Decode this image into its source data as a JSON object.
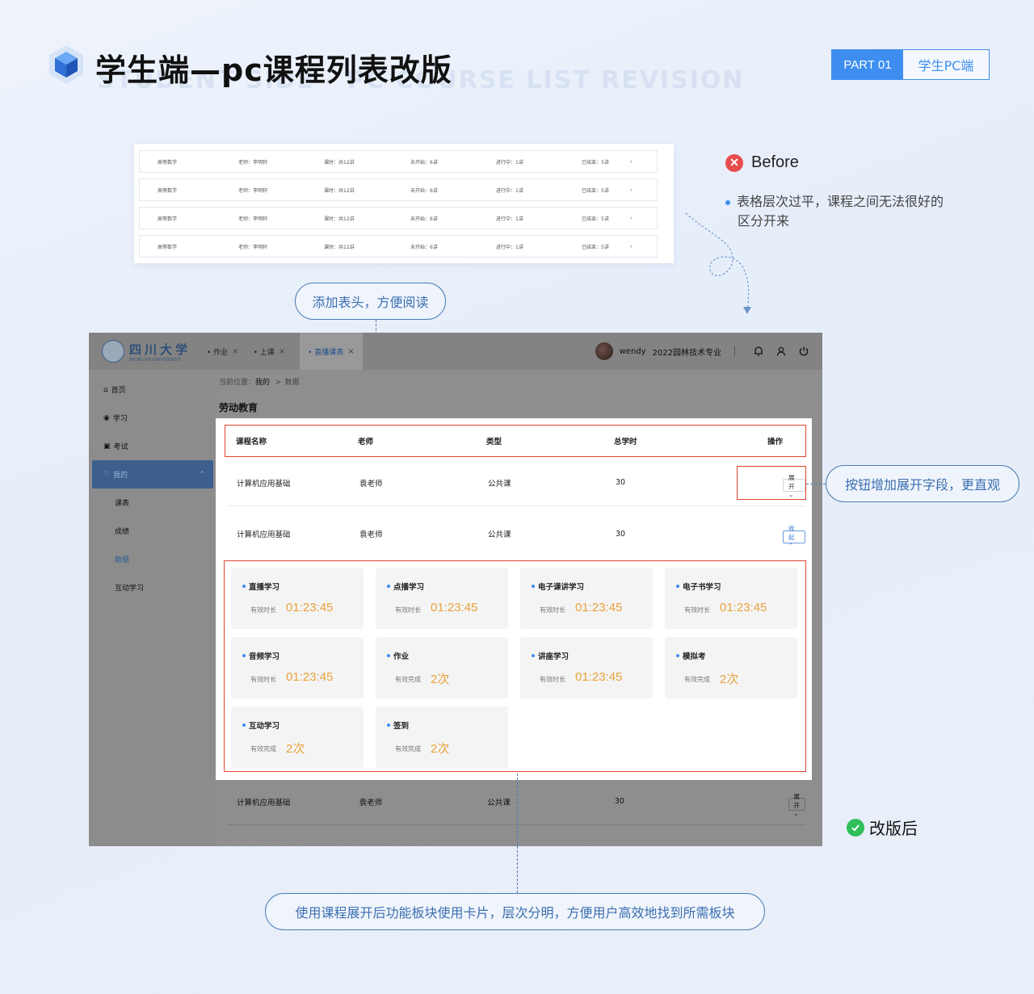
{
  "header": {
    "title_cn": "学生端—pc课程列表改版",
    "title_en": "STUDENT SIDE - PC COURSE LIST REVISION",
    "part_label": "PART 01",
    "part_name": "学生PC端"
  },
  "before": {
    "label": "Before",
    "desc_line1": "表格层次过平，课程之间无法很好的",
    "desc_line2": "区分开来",
    "rows": [
      {
        "course": "高等数学",
        "teacher": "老师：李明轩",
        "hours": "课时：共12讲",
        "not_started": "未开始：6讲",
        "ongoing": "进行中：1讲",
        "ended": "已结束：5讲",
        "arrow": "›"
      },
      {
        "course": "高等数学",
        "teacher": "老师：李明轩",
        "hours": "课时：共12讲",
        "not_started": "未开始：6讲",
        "ongoing": "进行中：1讲",
        "ended": "已结束：5讲",
        "arrow": "›"
      },
      {
        "course": "高等数学",
        "teacher": "老师：李明轩",
        "hours": "课时：共12讲",
        "not_started": "未开始：6讲",
        "ongoing": "进行中：1讲",
        "ended": "已结束：5讲",
        "arrow": "›"
      },
      {
        "course": "高等数学",
        "teacher": "老师：李明轩",
        "hours": "课时：共12讲",
        "not_started": "未开始：6讲",
        "ongoing": "进行中：1讲",
        "ended": "已结束：5讲",
        "arrow": "›"
      }
    ]
  },
  "callouts": {
    "header_note": "添加表头，方便阅读",
    "button_note": "按钮增加展开字段，更直观",
    "cards_note": "使用课程展开后功能板块使用卡片，层次分明，方便用户高效地找到所需板块"
  },
  "after_label": "改版后",
  "app": {
    "logo_cn": "四川大学",
    "logo_en": "SICHUAN UNIVERSITY",
    "tabs": [
      {
        "label": "• 作业",
        "close": "×"
      },
      {
        "label": "• 上课",
        "close": "×"
      },
      {
        "label": "• 直播课表",
        "close": "×"
      }
    ],
    "user_name": "wendy",
    "user_major": "2022园林技术专业",
    "sidebar": [
      {
        "icon": "⌂",
        "label": "首页"
      },
      {
        "icon": "◉",
        "label": "学习"
      },
      {
        "icon": "▣",
        "label": "考试"
      }
    ],
    "sidebar_active": {
      "icon": "♡",
      "label": "我的",
      "caret": "⌃"
    },
    "sidebar_sub": [
      "课表",
      "成绩",
      "数据",
      "互动学习"
    ],
    "breadcrumb_prefix": "当前位置：",
    "breadcrumb_1": "我的",
    "breadcrumb_sep": ">",
    "breadcrumb_2": "数据",
    "section_title": "劳动教育",
    "table_headers": [
      "课程名称",
      "老师",
      "类型",
      "总学时",
      "操作"
    ],
    "rows": [
      {
        "name": "计算机应用基础",
        "teacher": "袁老师",
        "type": "公共课",
        "hours": "30",
        "action": "展开 ⌄"
      },
      {
        "name": "计算机应用基础",
        "teacher": "袁老师",
        "type": "公共课",
        "hours": "30",
        "action": "收起 ⌃"
      },
      {
        "name": "计算机应用基础",
        "teacher": "袁老师",
        "type": "公共课",
        "hours": "30",
        "action": "展开 ⌄"
      }
    ],
    "cards": [
      {
        "title": "直播学习",
        "label": "有效时长",
        "value": "01:23:45"
      },
      {
        "title": "点播学习",
        "label": "有效时长",
        "value": "01:23:45"
      },
      {
        "title": "电子课讲学习",
        "label": "有效时长",
        "value": "01:23:45"
      },
      {
        "title": "电子书学习",
        "label": "有效时长",
        "value": "01:23:45"
      },
      {
        "title": "音频学习",
        "label": "有效时长",
        "value": "01:23:45"
      },
      {
        "title": "作业",
        "label": "有效完成",
        "value": "2次"
      },
      {
        "title": "讲座学习",
        "label": "有效时长",
        "value": "01:23:45"
      },
      {
        "title": "模拟考",
        "label": "有效完成",
        "value": "2次"
      },
      {
        "title": "互动学习",
        "label": "有效完成",
        "value": "2次"
      },
      {
        "title": "签到",
        "label": "有效完成",
        "value": "2次"
      }
    ]
  },
  "colors": {
    "accent": "#3d8ef0",
    "highlight": "#e0452f",
    "value": "#e9a23b",
    "callout": "#4c7cb3"
  }
}
